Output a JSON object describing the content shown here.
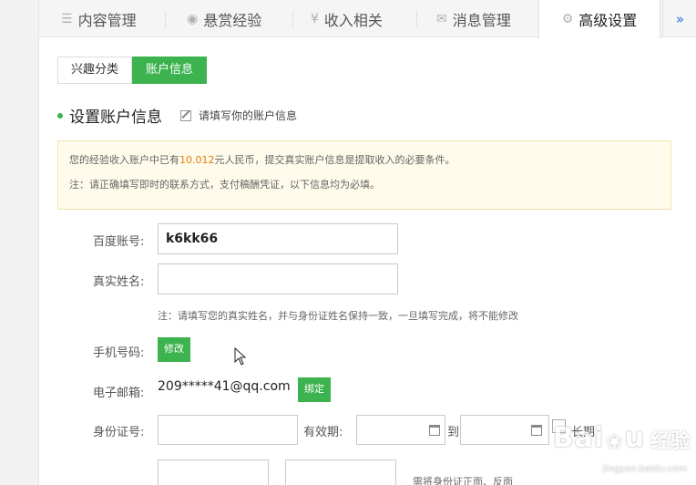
{
  "tabs": [
    {
      "label": "内容管理",
      "icon": "list-icon"
    },
    {
      "label": "悬赏经验",
      "icon": "coin-icon"
    },
    {
      "label": "收入相关",
      "icon": "yen-icon"
    },
    {
      "label": "消息管理",
      "icon": "mail-icon"
    },
    {
      "label": "高级设置",
      "icon": "gear-icon",
      "active": true
    }
  ],
  "more_label": "»",
  "subtabs": [
    {
      "label": "兴趣分类",
      "active": false
    },
    {
      "label": "账户信息",
      "active": true
    }
  ],
  "section": {
    "title": "设置账户信息",
    "hint": "请填写你的账户信息"
  },
  "notice": {
    "line1_pre": "您的经验收入账户中已有",
    "amount": "10.012",
    "line1_post": "元人民币，提交真实账户信息是提取收入的必要条件。",
    "line2": "注：请正确填写即时的联系方式，支付稿酬凭证，以下信息均为必填。"
  },
  "form": {
    "baidu_account_label": "百度账号:",
    "baidu_account_value": "k6kk66",
    "real_name_label": "真实姓名:",
    "real_name_value": "",
    "real_name_note": "注：请填写您的真实姓名，并与身份证姓名保持一致，一旦填写完成，将不能修改",
    "phone_label": "手机号码:",
    "phone_button": "修改",
    "email_label": "电子邮箱:",
    "email_value": "209*****41@qq.com",
    "email_button": "绑定",
    "id_label": "身份证号:",
    "validity_label": "有效期:",
    "to_label": "到",
    "long_term_label": "长期",
    "upload_note": "需将身份证正面、反面"
  },
  "watermark": {
    "logo": "Bai",
    "logo_end": "u",
    "text": "经验",
    "url": "jingyan.baidu.com"
  },
  "colors": {
    "accent_green": "#3cb34f",
    "amount_orange": "#e07b12",
    "link_blue": "#2d6fd8",
    "notice_bg": "#fffbea"
  }
}
